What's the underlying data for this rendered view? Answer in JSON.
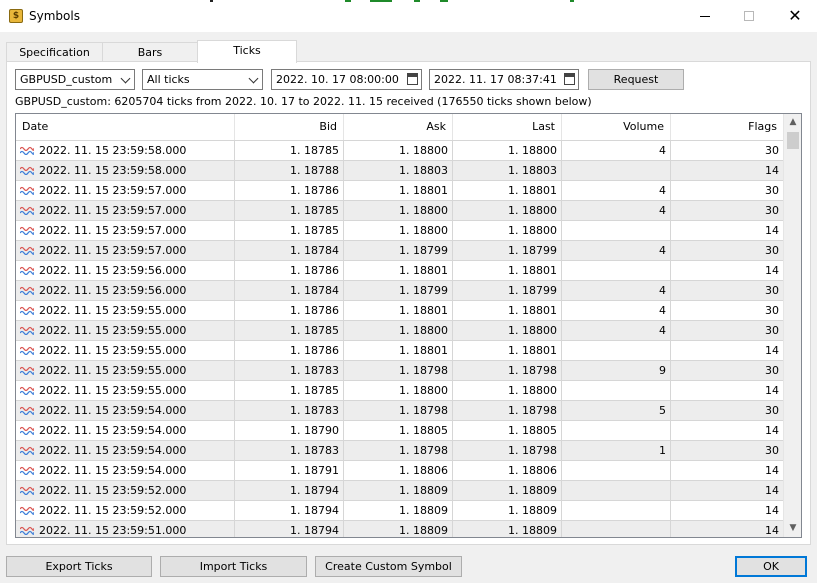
{
  "window": {
    "title": "Symbols",
    "icon": "symbols-app-icon",
    "close_glyph": "✕"
  },
  "tabs": [
    {
      "label": "Specification"
    },
    {
      "label": "Bars"
    },
    {
      "label": "Ticks"
    }
  ],
  "active_tab": "Ticks",
  "toolbar": {
    "symbol_value": "GBPUSD_custom",
    "tick_type_value": "All ticks",
    "date_from": "2022. 10. 17 08:00:00",
    "date_to": "2022. 11. 17 08:37:41",
    "request_label": "Request"
  },
  "info_text": "GBPUSD_custom: 6205704 ticks from 2022. 10. 17 to 2022. 11. 15 received (176550 ticks shown below)",
  "table": {
    "columns": [
      "Date",
      "Bid",
      "Ask",
      "Last",
      "Volume",
      "Flags"
    ],
    "rows": [
      [
        "2022. 11. 15 23:59:58.000",
        "1. 18785",
        "1. 18800",
        "1. 18800",
        "4",
        "30"
      ],
      [
        "2022. 11. 15 23:59:58.000",
        "1. 18788",
        "1. 18803",
        "1. 18803",
        "",
        "14"
      ],
      [
        "2022. 11. 15 23:59:57.000",
        "1. 18786",
        "1. 18801",
        "1. 18801",
        "4",
        "30"
      ],
      [
        "2022. 11. 15 23:59:57.000",
        "1. 18785",
        "1. 18800",
        "1. 18800",
        "4",
        "30"
      ],
      [
        "2022. 11. 15 23:59:57.000",
        "1. 18785",
        "1. 18800",
        "1. 18800",
        "",
        "14"
      ],
      [
        "2022. 11. 15 23:59:57.000",
        "1. 18784",
        "1. 18799",
        "1. 18799",
        "4",
        "30"
      ],
      [
        "2022. 11. 15 23:59:56.000",
        "1. 18786",
        "1. 18801",
        "1. 18801",
        "",
        "14"
      ],
      [
        "2022. 11. 15 23:59:56.000",
        "1. 18784",
        "1. 18799",
        "1. 18799",
        "4",
        "30"
      ],
      [
        "2022. 11. 15 23:59:55.000",
        "1. 18786",
        "1. 18801",
        "1. 18801",
        "4",
        "30"
      ],
      [
        "2022. 11. 15 23:59:55.000",
        "1. 18785",
        "1. 18800",
        "1. 18800",
        "4",
        "30"
      ],
      [
        "2022. 11. 15 23:59:55.000",
        "1. 18786",
        "1. 18801",
        "1. 18801",
        "",
        "14"
      ],
      [
        "2022. 11. 15 23:59:55.000",
        "1. 18783",
        "1. 18798",
        "1. 18798",
        "9",
        "30"
      ],
      [
        "2022. 11. 15 23:59:55.000",
        "1. 18785",
        "1. 18800",
        "1. 18800",
        "",
        "14"
      ],
      [
        "2022. 11. 15 23:59:54.000",
        "1. 18783",
        "1. 18798",
        "1. 18798",
        "5",
        "30"
      ],
      [
        "2022. 11. 15 23:59:54.000",
        "1. 18790",
        "1. 18805",
        "1. 18805",
        "",
        "14"
      ],
      [
        "2022. 11. 15 23:59:54.000",
        "1. 18783",
        "1. 18798",
        "1. 18798",
        "1",
        "30"
      ],
      [
        "2022. 11. 15 23:59:54.000",
        "1. 18791",
        "1. 18806",
        "1. 18806",
        "",
        "14"
      ],
      [
        "2022. 11. 15 23:59:52.000",
        "1. 18794",
        "1. 18809",
        "1. 18809",
        "",
        "14"
      ],
      [
        "2022. 11. 15 23:59:52.000",
        "1. 18794",
        "1. 18809",
        "1. 18809",
        "",
        "14"
      ],
      [
        "2022. 11. 15 23:59:51.000",
        "1. 18794",
        "1. 18809",
        "1. 18809",
        "",
        "14"
      ]
    ]
  },
  "footer_buttons": {
    "export_label": "Export Ticks",
    "import_label": "Import Ticks",
    "create_label": "Create Custom Symbol",
    "ok_label": "OK"
  },
  "colors": {
    "row_alt": "#ededed",
    "tick_icon_red": "#d9534f",
    "tick_icon_blue": "#3b7dd8",
    "focus_border": "#0078d7"
  }
}
